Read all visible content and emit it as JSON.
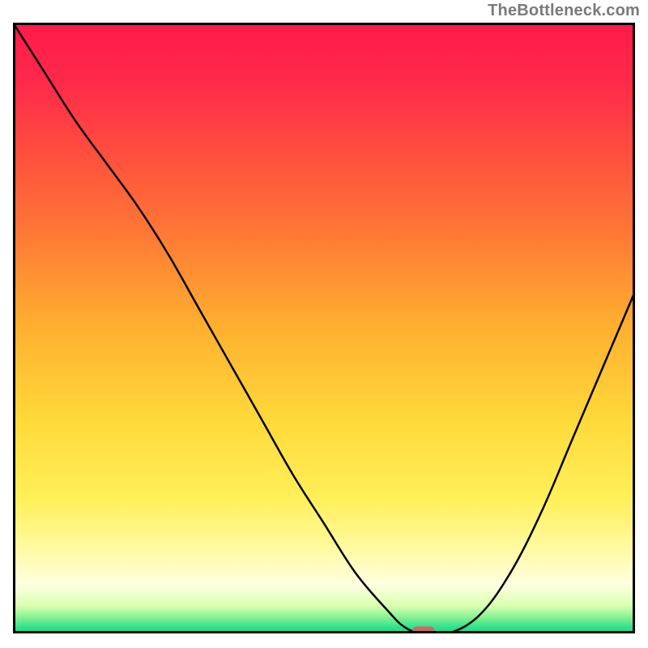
{
  "attribution": "TheBottleneck.com",
  "chart_data": {
    "type": "line",
    "title": "",
    "xlabel": "",
    "ylabel": "",
    "xlim": [
      0,
      100
    ],
    "ylim": [
      0,
      100
    ],
    "x": [
      0,
      5,
      10,
      15,
      20,
      25,
      30,
      35,
      40,
      45,
      50,
      55,
      60,
      63,
      66,
      70,
      75,
      80,
      85,
      90,
      95,
      100
    ],
    "values": [
      100,
      92,
      84,
      77,
      70,
      62,
      53,
      44,
      35,
      26,
      18,
      10,
      4,
      1,
      0,
      0,
      3,
      10,
      20,
      32,
      44,
      56
    ],
    "marker": {
      "x": 66,
      "y": 0,
      "width_pct": 3.5,
      "height_pct": 1.5,
      "color": "#c96a6a"
    },
    "gradient_stops": [
      {
        "offset": 0.0,
        "color": "#ff1a4a"
      },
      {
        "offset": 0.1,
        "color": "#ff2a4a"
      },
      {
        "offset": 0.2,
        "color": "#ff4a3f"
      },
      {
        "offset": 0.35,
        "color": "#ff7a35"
      },
      {
        "offset": 0.5,
        "color": "#ffb030"
      },
      {
        "offset": 0.65,
        "color": "#ffd93a"
      },
      {
        "offset": 0.78,
        "color": "#fff05a"
      },
      {
        "offset": 0.86,
        "color": "#fffaa0"
      },
      {
        "offset": 0.92,
        "color": "#ffffe0"
      },
      {
        "offset": 0.955,
        "color": "#d8ffb0"
      },
      {
        "offset": 0.975,
        "color": "#80f090"
      },
      {
        "offset": 0.99,
        "color": "#30e090"
      },
      {
        "offset": 1.0,
        "color": "#14d987"
      }
    ]
  }
}
